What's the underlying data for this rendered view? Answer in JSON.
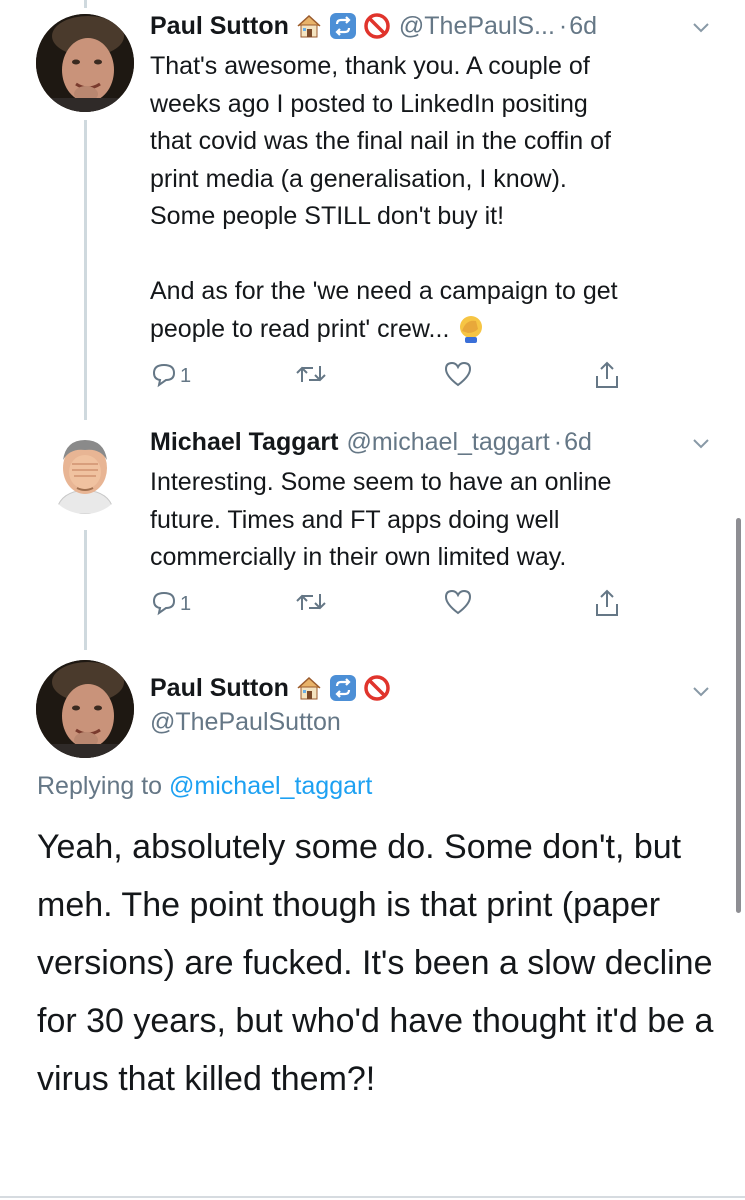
{
  "tweets": [
    {
      "name": "Paul Sutton",
      "handle": "@ThePaulS...",
      "dot": "·",
      "time": "6d",
      "text": "That's awesome, thank you. A couple of\nweeks ago I posted to LinkedIn positing\nthat covid was the final nail in the coffin of\nprint media (a generalisation, I know).\nSome people STILL don't buy it!\n\nAnd as for the 'we need a campaign to get\npeople to read print' crew...",
      "reply_count": "1"
    },
    {
      "name": "Michael Taggart",
      "handle": "@michael_taggart",
      "dot": "·",
      "time": "6d",
      "text": "Interesting. Some seem to have an online\nfuture. Times and FT apps doing well\ncommercially in their own limited way.",
      "reply_count": "1"
    }
  ],
  "main": {
    "name": "Paul Sutton",
    "handle": "@ThePaulSutton",
    "replying_prefix": "Replying to ",
    "replying_mention": "@michael_taggart",
    "text": "Yeah, absolutely some do. Some don't, but meh. The point though is that print (paper versions) are fucked. It's been a slow decline for 30 years, but who'd have thought it'd be a virus that killed them?!"
  },
  "icons": {
    "badges": [
      "house-icon",
      "retweet-badge-icon",
      "no-entry-icon"
    ],
    "actions": [
      "reply-icon",
      "retweet-icon",
      "like-icon",
      "share-icon"
    ],
    "menu": "chevron-down-icon",
    "facepalm": "facepalm-emoji-icon"
  },
  "colors": {
    "text": "#14171a",
    "secondary": "#657786",
    "link": "#1da1f2",
    "thread_line": "#cfd9de"
  }
}
